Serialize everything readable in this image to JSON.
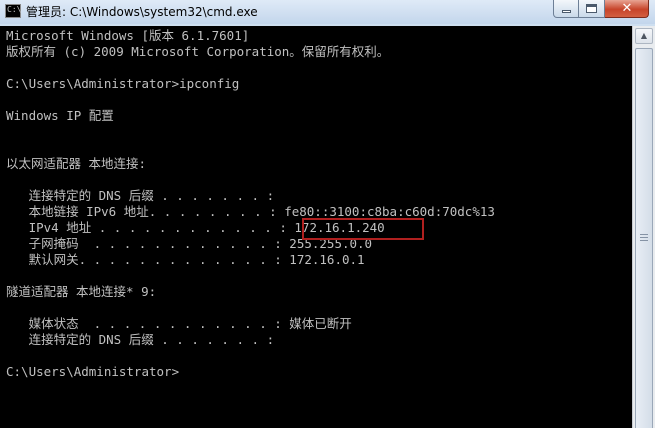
{
  "window": {
    "title": "管理员: C:\\Windows\\system32\\cmd.exe",
    "icon": "cmd-console-icon",
    "icon_glyph": "C:\\",
    "buttons": {
      "minimize": "minimize-icon",
      "maximize": "maximize-icon",
      "close": "close-icon",
      "close_glyph": "✕"
    }
  },
  "console": {
    "lines": [
      "Microsoft Windows [版本 6.1.7601]",
      "版权所有 (c) 2009 Microsoft Corporation。保留所有权利。",
      "",
      "C:\\Users\\Administrator>ipconfig",
      "",
      "Windows IP 配置",
      "",
      "",
      "以太网适配器 本地连接:",
      "",
      "   连接特定的 DNS 后缀 . . . . . . . :",
      "   本地链接 IPv6 地址. . . . . . . . : fe80::3100:c8ba:c60d:70dc%13",
      "   IPv4 地址 . . . . . . . . . . . . : 172.16.1.240",
      "   子网掩码  . . . . . . . . . . . . : 255.255.0.0",
      "   默认网关. . . . . . . . . . . . . : 172.16.0.1",
      "",
      "隧道适配器 本地连接* 9:",
      "",
      "   媒体状态  . . . . . . . . . . . . : 媒体已断开",
      "   连接特定的 DNS 后缀 . . . . . . . :",
      "",
      "C:\\Users\\Administrator>"
    ],
    "highlighted_value": "172.16.1.240",
    "highlight_color": "#b0201f",
    "text_color": "#c0c0c0",
    "background_color": "#000000"
  },
  "scrollbar": {
    "up_arrow": "▲",
    "position": 0
  }
}
